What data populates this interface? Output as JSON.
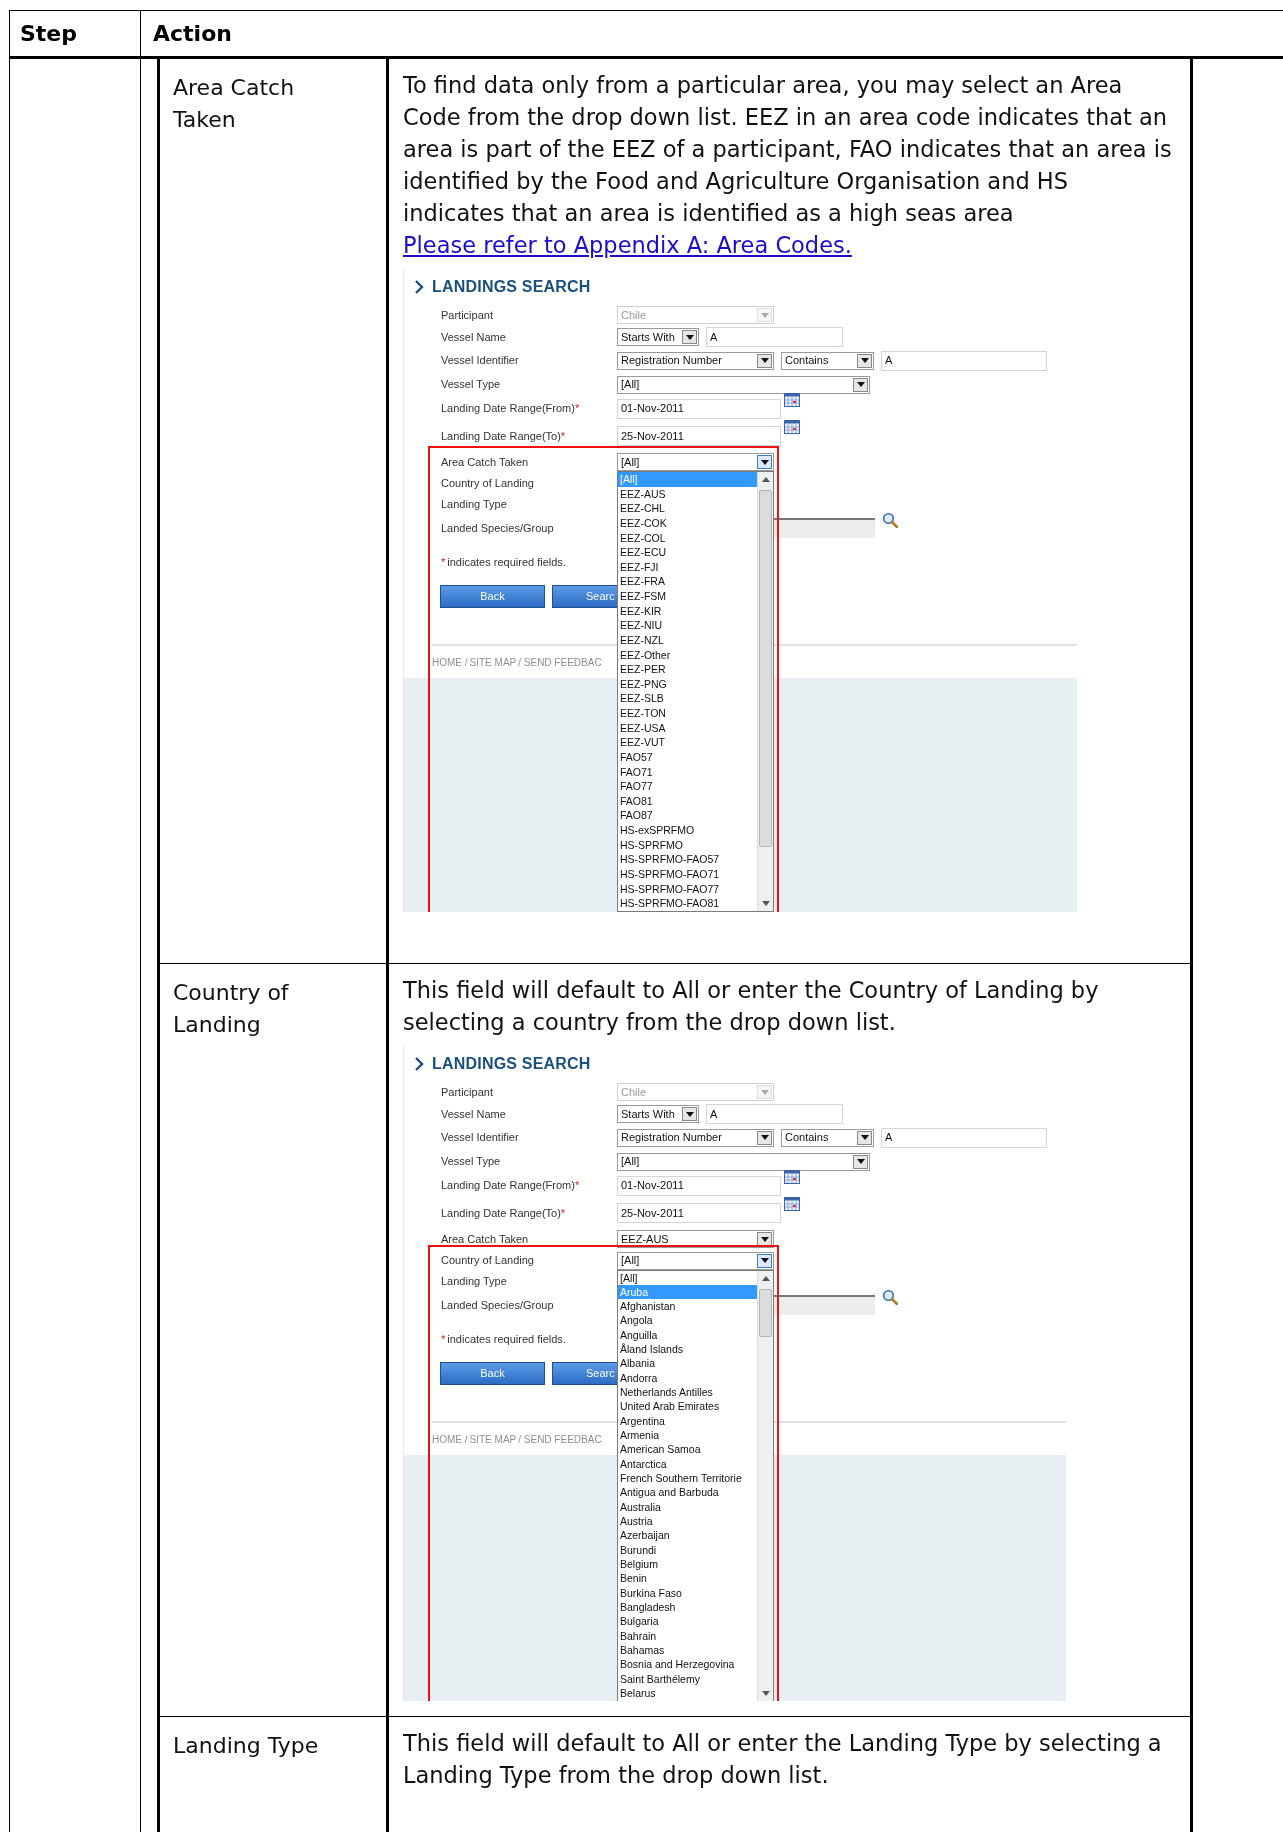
{
  "table": {
    "columns": [
      "Step",
      "Action"
    ],
    "rows": [
      {
        "field": "Area Catch Taken",
        "description": "To find data only from a particular area, you may select an Area Code from the drop down list. EEZ in an area code indicates that an area is part of the EEZ of a participant, FAO indicates that an area is identified by the Food and Agriculture Organisation and HS indicates that an area is identified as a high seas area",
        "link": "Please refer to Appendix A: Area Codes.",
        "screenshot": {
          "title": "LANDINGS SEARCH",
          "fields": [
            {
              "label": "Participant",
              "controls": [
                {
                  "kind": "select",
                  "value": "Chile",
                  "disabled": true,
                  "open": false
                }
              ]
            },
            {
              "label": "Vessel Name",
              "controls": [
                {
                  "kind": "select",
                  "value": "Starts With",
                  "disabled": false,
                  "open": false
                },
                {
                  "kind": "input",
                  "value": "A"
                }
              ]
            },
            {
              "label": "Vessel Identifier",
              "controls": [
                {
                  "kind": "select",
                  "value": "Registration Number",
                  "disabled": false,
                  "open": false
                },
                {
                  "kind": "select",
                  "value": "Contains",
                  "disabled": false,
                  "open": false
                },
                {
                  "kind": "input",
                  "value": "A"
                }
              ]
            },
            {
              "label": "Vessel Type",
              "controls": [
                {
                  "kind": "select",
                  "value": "[All]",
                  "disabled": false,
                  "open": false
                }
              ]
            },
            {
              "label": "Landing Date Range(From)",
              "mark": "*",
              "controls": [
                {
                  "kind": "date",
                  "value": "01-Nov-2011"
                }
              ]
            },
            {
              "label": "Landing Date Range(To)",
              "mark": "*",
              "controls": [
                {
                  "kind": "date",
                  "value": "25-Nov-2011"
                }
              ]
            },
            {
              "label": "Area Catch Taken",
              "controls": [
                {
                  "kind": "select",
                  "value": "[All]",
                  "disabled": false,
                  "open": true
                }
              ]
            },
            {
              "label": "Country of Landing"
            },
            {
              "label": "Landing Type"
            },
            {
              "label": "Landed Species/Group",
              "controls": [
                {
                  "kind": "lookup"
                }
              ]
            }
          ],
          "note": {
            "mark": "*",
            "text": "indicates required fields."
          },
          "buttons": [
            "Back",
            "Searc"
          ],
          "footer_links": [
            "HOME /",
            "SITE MAP",
            "/ SEND FEEDBAC"
          ],
          "dropdown": {
            "items": [
              {
                "label": "[All]",
                "selected": true
              },
              {
                "label": "EEZ-AUS",
                "selected": false
              },
              {
                "label": "EEZ-CHL",
                "selected": false
              },
              {
                "label": "EEZ-COK",
                "selected": false
              },
              {
                "label": "EEZ-COL",
                "selected": false
              },
              {
                "label": "EEZ-ECU",
                "selected": false
              },
              {
                "label": "EEZ-FJI",
                "selected": false
              },
              {
                "label": "EEZ-FRA",
                "selected": false
              },
              {
                "label": "EEZ-FSM",
                "selected": false
              },
              {
                "label": "EEZ-KIR",
                "selected": false
              },
              {
                "label": "EEZ-NIU",
                "selected": false
              },
              {
                "label": "EEZ-NZL",
                "selected": false
              },
              {
                "label": "EEZ-Other",
                "selected": false
              },
              {
                "label": "EEZ-PER",
                "selected": false
              },
              {
                "label": "EEZ-PNG",
                "selected": false
              },
              {
                "label": "EEZ-SLB",
                "selected": false
              },
              {
                "label": "EEZ-TON",
                "selected": false
              },
              {
                "label": "EEZ-USA",
                "selected": false
              },
              {
                "label": "EEZ-VUT",
                "selected": false
              },
              {
                "label": "FAO57",
                "selected": false
              },
              {
                "label": "FAO71",
                "selected": false
              },
              {
                "label": "FAO77",
                "selected": false
              },
              {
                "label": "FAO81",
                "selected": false
              },
              {
                "label": "FAO87",
                "selected": false
              },
              {
                "label": "HS-exSPRFMO",
                "selected": false
              },
              {
                "label": "HS-SPRFMO",
                "selected": false
              },
              {
                "label": "HS-SPRFMO-FAO57",
                "selected": false
              },
              {
                "label": "HS-SPRFMO-FAO71",
                "selected": false
              },
              {
                "label": "HS-SPRFMO-FAO77",
                "selected": false
              },
              {
                "label": "HS-SPRFMO-FAO81",
                "selected": false
              }
            ]
          }
        }
      },
      {
        "field": "Country of Landing",
        "description": "This field will default to All or enter the Country of Landing by selecting a country from the drop down list.",
        "screenshot": {
          "title": "LANDINGS SEARCH",
          "fields": [
            {
              "label": "Participant",
              "controls": [
                {
                  "kind": "select",
                  "value": "Chile",
                  "disabled": true,
                  "open": false
                }
              ]
            },
            {
              "label": "Vessel Name",
              "controls": [
                {
                  "kind": "select",
                  "value": "Starts With",
                  "disabled": false,
                  "open": false
                },
                {
                  "kind": "input",
                  "value": "A"
                }
              ]
            },
            {
              "label": "Vessel Identifier",
              "controls": [
                {
                  "kind": "select",
                  "value": "Registration Number",
                  "disabled": false,
                  "open": false
                },
                {
                  "kind": "select",
                  "value": "Contains",
                  "disabled": false,
                  "open": false
                },
                {
                  "kind": "input",
                  "value": "A"
                }
              ]
            },
            {
              "label": "Vessel Type",
              "controls": [
                {
                  "kind": "select",
                  "value": "[All]",
                  "disabled": false,
                  "open": false
                }
              ]
            },
            {
              "label": "Landing Date Range(From)",
              "mark": "*",
              "controls": [
                {
                  "kind": "date",
                  "value": "01-Nov-2011"
                }
              ]
            },
            {
              "label": "Landing Date Range(To)",
              "mark": "*",
              "controls": [
                {
                  "kind": "date",
                  "value": "25-Nov-2011"
                }
              ]
            },
            {
              "label": "Area Catch Taken",
              "controls": [
                {
                  "kind": "select",
                  "value": "EEZ-AUS",
                  "disabled": false,
                  "open": false
                }
              ]
            },
            {
              "label": "Country of Landing",
              "controls": [
                {
                  "kind": "select",
                  "value": "[All]",
                  "disabled": false,
                  "open": true
                }
              ]
            },
            {
              "label": "Landing Type"
            },
            {
              "label": "Landed Species/Group",
              "controls": [
                {
                  "kind": "lookup"
                }
              ]
            }
          ],
          "note": {
            "mark": "*",
            "text": "indicates required fields."
          },
          "buttons": [
            "Back",
            "Searc"
          ],
          "footer_links": [
            "HOME /",
            "SITE MAP",
            "/ SEND FEEDBAC"
          ],
          "dropdown": {
            "items": [
              {
                "label": "[All]",
                "selected": false
              },
              {
                "label": "Aruba",
                "selected": true
              },
              {
                "label": "Afghanistan",
                "selected": false
              },
              {
                "label": "Angola",
                "selected": false
              },
              {
                "label": "Anguilla",
                "selected": false
              },
              {
                "label": "Åland Islands",
                "selected": false
              },
              {
                "label": "Albania",
                "selected": false
              },
              {
                "label": "Andorra",
                "selected": false
              },
              {
                "label": "Netherlands Antilles",
                "selected": false
              },
              {
                "label": "United Arab Emirates",
                "selected": false
              },
              {
                "label": "Argentina",
                "selected": false
              },
              {
                "label": "Armenia",
                "selected": false
              },
              {
                "label": "American Samoa",
                "selected": false
              },
              {
                "label": "Antarctica",
                "selected": false
              },
              {
                "label": "French Southern Territorie",
                "selected": false
              },
              {
                "label": "Antigua and Barbuda",
                "selected": false
              },
              {
                "label": "Australia",
                "selected": false
              },
              {
                "label": "Austria",
                "selected": false
              },
              {
                "label": "Azerbaijan",
                "selected": false
              },
              {
                "label": "Burundi",
                "selected": false
              },
              {
                "label": "Belgium",
                "selected": false
              },
              {
                "label": "Benin",
                "selected": false
              },
              {
                "label": "Burkina Faso",
                "selected": false
              },
              {
                "label": "Bangladesh",
                "selected": false
              },
              {
                "label": "Bulgaria",
                "selected": false
              },
              {
                "label": "Bahrain",
                "selected": false
              },
              {
                "label": "Bahamas",
                "selected": false
              },
              {
                "label": "Bosnia and Herzegovina",
                "selected": false
              },
              {
                "label": "Saint Barthélemy",
                "selected": false
              },
              {
                "label": "Belarus",
                "selected": false
              }
            ]
          }
        }
      },
      {
        "field": "Landing Type",
        "description": "This field will default to All or enter the Landing Type by selecting a Landing Type from the drop down list."
      }
    ]
  }
}
